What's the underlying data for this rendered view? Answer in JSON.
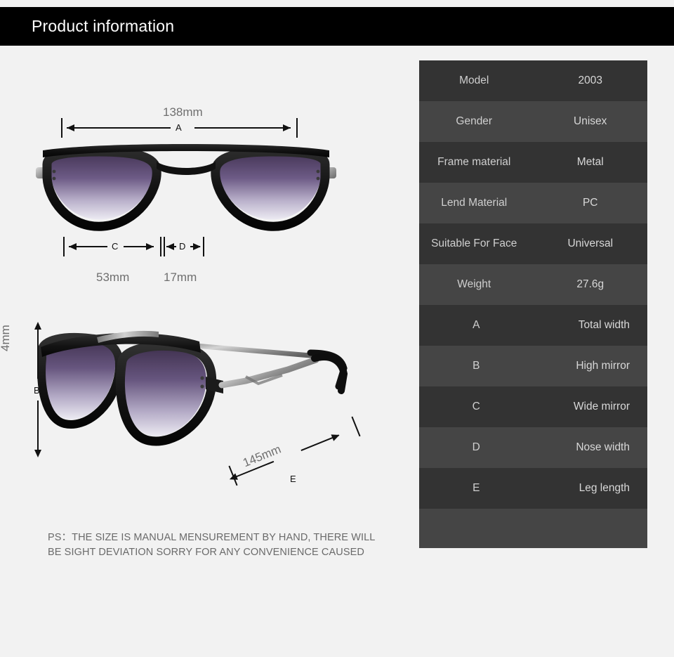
{
  "header": {
    "title": "Product information"
  },
  "page": {
    "background_color": "#f2f2f2",
    "header_background": "#000000",
    "header_text_color": "#ffffff",
    "table_row_dark": "#333333",
    "table_row_light": "#454545",
    "table_text_color": "#cfcfcf",
    "dim_label_color": "#6f6f6f",
    "note_text_color": "#6a6a6a"
  },
  "diagram": {
    "front_view": {
      "name": "sunglasses-front-view",
      "measurements": {
        "total_width": {
          "value": "138mm",
          "letter": "A"
        },
        "lens_width": {
          "value": "53mm",
          "letter": "C"
        },
        "nose_width": {
          "value": "17mm",
          "letter": "D"
        }
      }
    },
    "angled_view": {
      "name": "sunglasses-angled-view",
      "measurements": {
        "lens_height": {
          "value": "4mm",
          "letter": "B"
        },
        "temple_length": {
          "value": "145mm",
          "letter": "E"
        }
      }
    }
  },
  "note": {
    "line1": "PS：THE SIZE IS MANUAL MENSUREMENT BY HAND, THERE WILL",
    "line2": "BE SIGHT DEVIATION SORRY FOR ANY CONVENIENCE CAUSED"
  },
  "spec_table": {
    "rows": [
      {
        "key": "Model",
        "value": "2003",
        "type": "spec"
      },
      {
        "key": "Gender",
        "value": "Unisex",
        "type": "spec"
      },
      {
        "key": "Frame material",
        "value": "Metal",
        "type": "spec"
      },
      {
        "key": "Lend Material",
        "value": "PC",
        "type": "spec"
      },
      {
        "key": "Suitable For Face",
        "value": "Universal",
        "type": "spec"
      },
      {
        "key": "Weight",
        "value": "27.6g",
        "type": "spec"
      },
      {
        "key": "A",
        "value": "Total width",
        "type": "legend"
      },
      {
        "key": "B",
        "value": "High mirror",
        "type": "legend"
      },
      {
        "key": "C",
        "value": "Wide mirror",
        "type": "legend"
      },
      {
        "key": "D",
        "value": "Nose width",
        "type": "legend"
      },
      {
        "key": "E",
        "value": "Leg length",
        "type": "legend"
      },
      {
        "key": "",
        "value": "",
        "type": "blank"
      }
    ]
  }
}
